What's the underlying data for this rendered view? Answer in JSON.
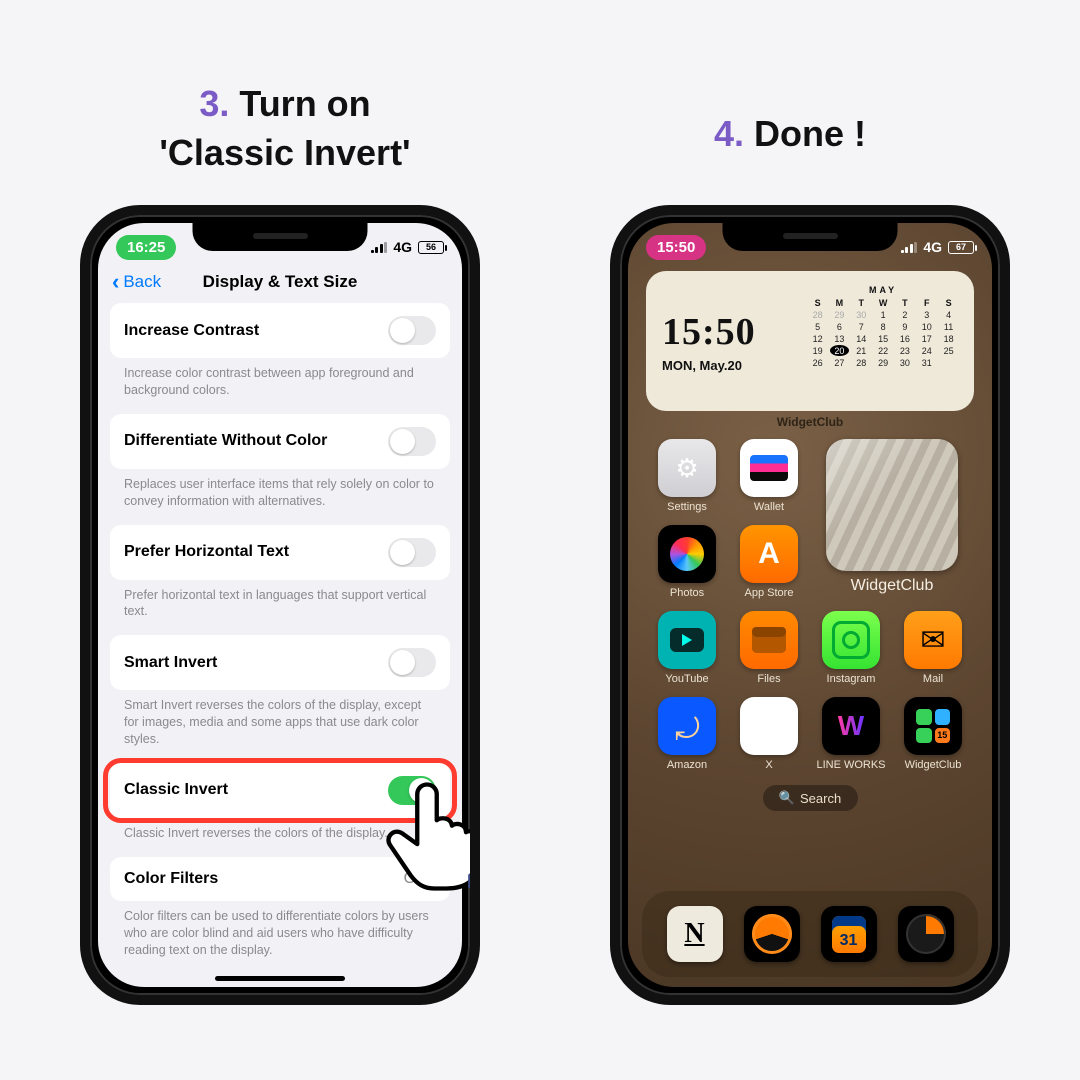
{
  "captions": {
    "step3_num": "3.",
    "step3_a": "Turn on",
    "step3_b": "'Classic Invert'",
    "step4_num": "4.",
    "step4": "Done !"
  },
  "phone1": {
    "status": {
      "time": "16:25",
      "net": "4G",
      "batt": "56"
    },
    "nav": {
      "back": "Back",
      "title": "Display & Text Size"
    },
    "rows": {
      "contrast": {
        "label": "Increase Contrast",
        "footer": "Increase color contrast between app foreground and background colors."
      },
      "diff": {
        "label": "Differentiate Without Color",
        "footer": "Replaces user interface items that rely solely on color to convey information with alternatives."
      },
      "horiz": {
        "label": "Prefer Horizontal Text",
        "footer": "Prefer horizontal text in languages that support vertical text."
      },
      "smart": {
        "label": "Smart Invert",
        "footer": "Smart Invert reverses the colors of the display, except for images, media and some apps that use dark color styles."
      },
      "classic": {
        "label": "Classic Invert",
        "footer": "Classic Invert reverses the colors of the display."
      },
      "filters": {
        "label": "Color Filters",
        "value": "Off",
        "footer": "Color filters can be used to differentiate colors by users who are color blind and aid users who have difficulty reading text on the display."
      }
    }
  },
  "phone2": {
    "status": {
      "time": "15:50",
      "net": "4G",
      "batt": "67"
    },
    "widget": {
      "time": "15:50",
      "date": "MON, May.20",
      "month": "MAY",
      "dow": [
        "S",
        "M",
        "T",
        "W",
        "T",
        "F",
        "S"
      ],
      "leading_dim": [
        28,
        29,
        30
      ],
      "days": 31,
      "today": 20,
      "label": "WidgetClub",
      "photo_label": "WidgetClub"
    },
    "apps": {
      "settings": "Settings",
      "wallet": "Wallet",
      "photos": "Photos",
      "appstore": "App Store",
      "youtube": "YouTube",
      "files": "Files",
      "instagram": "Instagram",
      "mail": "Mail",
      "amazon": "Amazon",
      "x": "X",
      "lineworks": "LINE WORKS",
      "widgetclub": "WidgetClub",
      "wclub_badge": "15"
    },
    "search": "Search"
  }
}
